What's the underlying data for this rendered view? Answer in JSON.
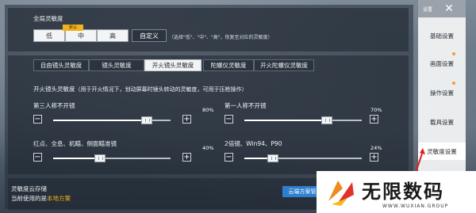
{
  "global": {
    "title": "全局灵敏度",
    "presets": [
      "低",
      "中",
      "高",
      "自定义"
    ],
    "badge": "默认",
    "hint": "（选择\"低\"、\"中\"、\"高\"，恢复至对应的灵敏度）"
  },
  "tabs": [
    "自由镜头灵敏度",
    "镜头灵敏度",
    "开火镜头灵敏度",
    "陀螺仪灵敏度",
    "开火陀螺仪灵敏度"
  ],
  "active_tab": 2,
  "section": {
    "title": "开火镜头灵敏度",
    "hint": "（用于开火情况下，划动屏幕时镜头转动的灵敏度，可用于压枪操作）"
  },
  "sliders": [
    {
      "label": "第三人称不开镜",
      "value": 0.8,
      "percent": "80%"
    },
    {
      "label": "第一人称不开镜",
      "value": 0.7,
      "percent": "70%"
    },
    {
      "label": "红点、全息、机瞄、侧面瞄准镜",
      "value": 0.4,
      "percent": "40%"
    },
    {
      "label": "2倍镜、Win94、P90",
      "value": 0.24,
      "percent": "24%"
    }
  ],
  "cloud": {
    "title": "灵敏度云存储",
    "current_prefix": "当前使用的是",
    "current_value": "本地方案",
    "button": "云端方案管"
  },
  "sidebar": {
    "title": "设置",
    "items": [
      "基础设置",
      "画面设置",
      "操作设置",
      "载具设置",
      "灵敏度设置"
    ],
    "active": 4
  },
  "watermark": {
    "name": "无限数码",
    "url": "WWW.WUXIAN.GROUP"
  },
  "colors": {
    "accent": "#f2b21c",
    "button_blue": "#2f7fd0"
  }
}
